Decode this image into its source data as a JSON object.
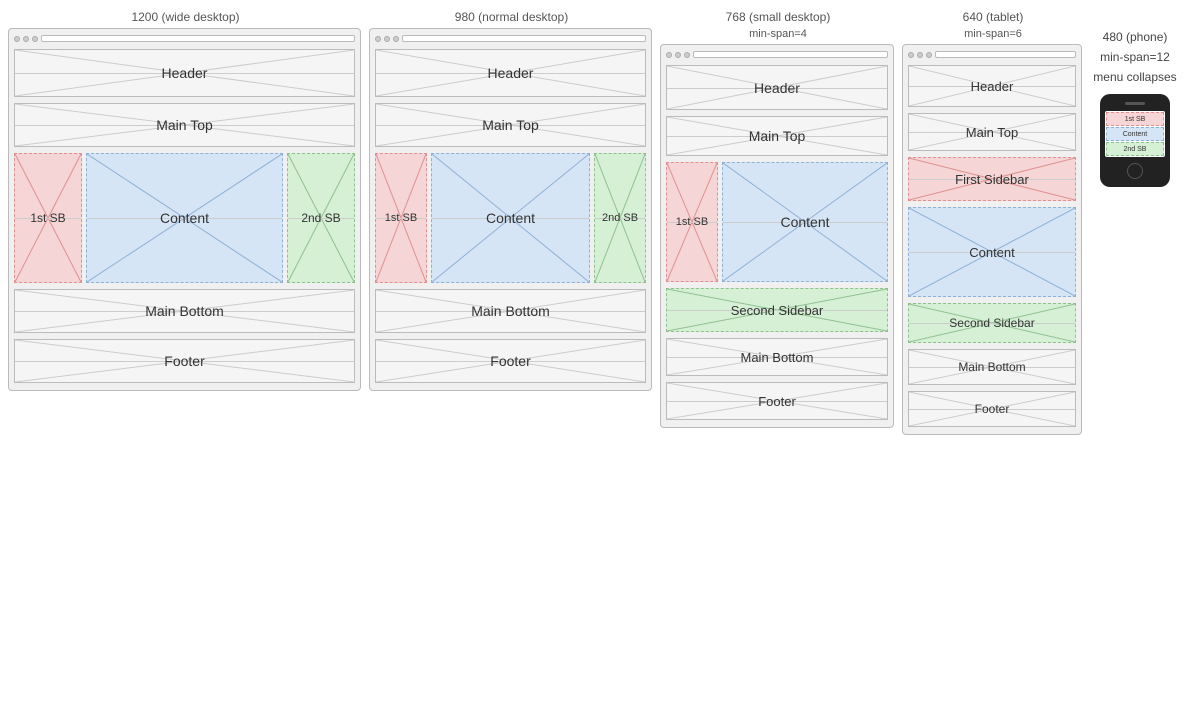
{
  "layouts": [
    {
      "id": "layout1",
      "title": "1200 (wide desktop)",
      "header": "Header",
      "main_top": "Main Top",
      "sidebar1": "1st SB",
      "content": "Content",
      "sidebar2": "2nd SB",
      "main_bottom": "Main Bottom",
      "footer": "Footer"
    },
    {
      "id": "layout2",
      "title": "980 (normal desktop)",
      "header": "Header",
      "main_top": "Main Top",
      "sidebar1": "1st SB",
      "content": "Content",
      "sidebar2": "2nd SB",
      "main_bottom": "Main Bottom",
      "footer": "Footer"
    },
    {
      "id": "layout3",
      "title": "768 (small desktop)",
      "subtitle": "min-span=4",
      "header": "Header",
      "main_top": "Main Top",
      "sidebar1": "1st SB",
      "content": "Content",
      "second_sidebar": "Second Sidebar",
      "main_bottom": "Main Bottom",
      "footer": "Footer"
    },
    {
      "id": "layout4",
      "title": "640 (tablet)",
      "subtitle": "min-span=6",
      "header": "Header",
      "main_top": "Main Top",
      "first_sidebar": "First Sidebar",
      "content": "Content",
      "second_sidebar": "Second Sidebar",
      "main_bottom": "Main Bottom",
      "footer": "Footer"
    }
  ],
  "phone": {
    "title": "480 (phone)",
    "subtitle1": "min-span=12",
    "subtitle2": "menu collapses",
    "bar1": "1st SB",
    "bar2": "Content",
    "bar3": "2nd SB"
  }
}
